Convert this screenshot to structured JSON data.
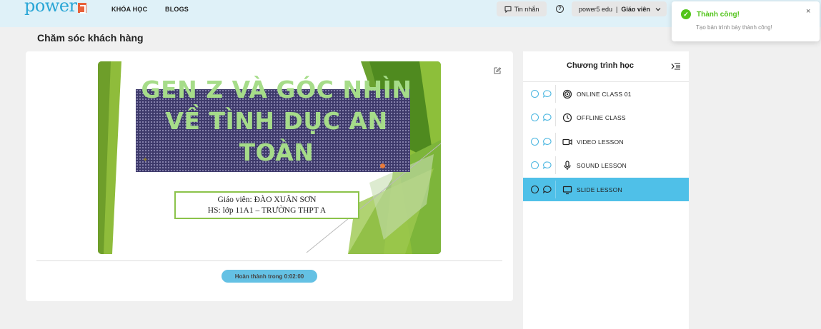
{
  "header": {
    "logo_text": "power",
    "nav": [
      "KHÓA HỌC",
      "BLOGS"
    ],
    "messages_label": "Tin nhắn",
    "help_icon": "?",
    "user_name": "power5 edu",
    "user_separator": "|",
    "user_role": "Giáo viên"
  },
  "toast": {
    "title": "Thành công!",
    "message": "Tạo bản trình bày thành công!",
    "close": "×",
    "check": "✓",
    "status_color": "#52c41a"
  },
  "page": {
    "title": "Chăm sóc khách hàng"
  },
  "slide": {
    "title": "GEN Z VÀ GÓC NHÌN VỀ TÌNH DỤC AN TOÀN",
    "teacher_line": "Giáo viên: ĐÀO XUÂN SƠN",
    "student_line": "HS: lớp 11A1 – TRƯỜNG THPT A",
    "accent_color": "#8bc34a"
  },
  "footer": {
    "complete_label": "Hoàn thành trong 0:02:00"
  },
  "sidebar": {
    "title": "Chương trình học",
    "active_color": "#4fc0e8",
    "lessons": [
      {
        "label": "ONLINE CLASS 01",
        "icon": "target-icon",
        "active": false
      },
      {
        "label": "OFFLINE CLASS",
        "icon": "clock-icon",
        "active": false
      },
      {
        "label": "VIDEO LESSON",
        "icon": "video-icon",
        "active": false
      },
      {
        "label": "SOUND LESSON",
        "icon": "microphone-icon",
        "active": false
      },
      {
        "label": "SLIDE LESSON",
        "icon": "monitor-icon",
        "active": true
      }
    ]
  }
}
